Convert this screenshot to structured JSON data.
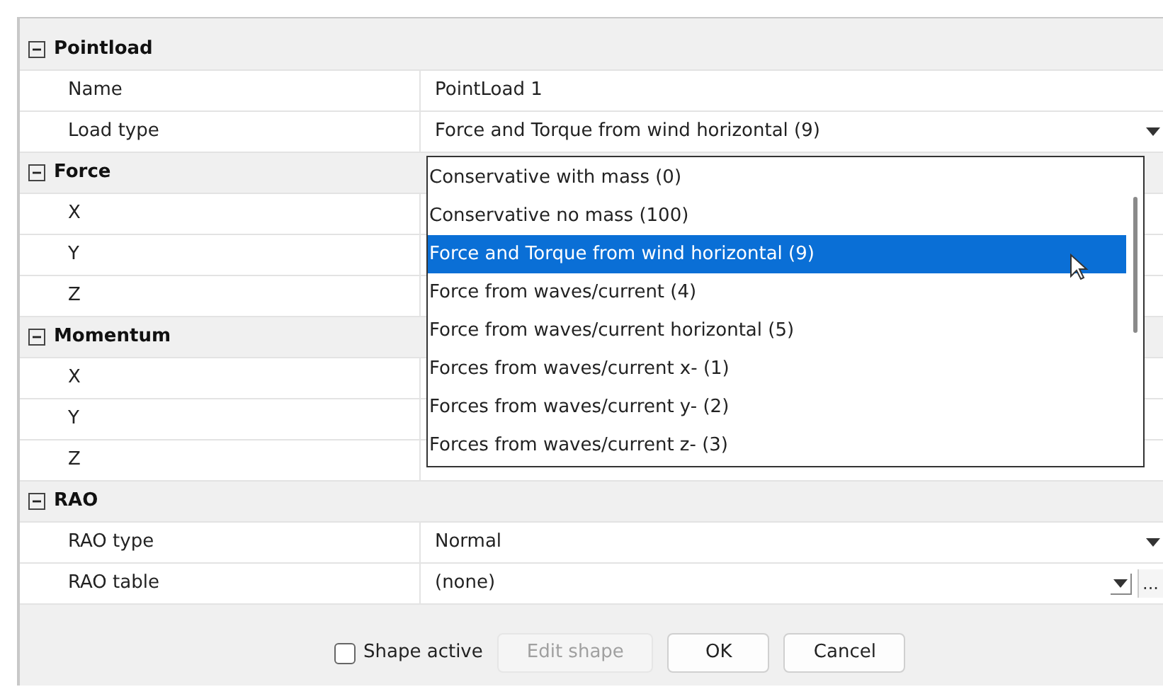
{
  "sections": [
    {
      "title": "Pointload",
      "expanded": true,
      "rows": [
        {
          "label": "Name",
          "kind": "text",
          "value": "PointLoad 1"
        },
        {
          "label": "Load type",
          "kind": "dropdown",
          "value": "Force and Torque from wind horizontal (9)"
        }
      ]
    },
    {
      "title": "Force",
      "expanded": true,
      "rows": [
        {
          "label": "X",
          "kind": "text"
        },
        {
          "label": "Y",
          "kind": "text"
        },
        {
          "label": "Z",
          "kind": "text"
        }
      ]
    },
    {
      "title": "Momentum",
      "expanded": true,
      "rows": [
        {
          "label": "X",
          "kind": "text"
        },
        {
          "label": "Y",
          "kind": "text"
        },
        {
          "label": "Z",
          "kind": "text"
        }
      ]
    },
    {
      "title": "RAO",
      "expanded": true,
      "rows": [
        {
          "label": "RAO type",
          "kind": "dropdown",
          "value": "Normal"
        },
        {
          "label": "RAO table",
          "kind": "browse",
          "value": "(none)",
          "browse": "..."
        }
      ]
    }
  ],
  "dropdown_list": {
    "items": [
      {
        "label": "Conservative with mass (0)",
        "selected": false
      },
      {
        "label": "Conservative no mass (100)",
        "selected": false
      },
      {
        "label": "Force and Torque from wind horizontal (9)",
        "selected": true
      },
      {
        "label": "Force from waves/current (4)",
        "selected": false
      },
      {
        "label": "Force from waves/current horizontal (5)",
        "selected": false
      },
      {
        "label": "Forces from waves/current x- (1)",
        "selected": false
      },
      {
        "label": "Forces from waves/current y- (2)",
        "selected": false
      },
      {
        "label": "Forces from waves/current z- (3)",
        "selected": false
      }
    ]
  },
  "footer": {
    "checkbox": {
      "label": "Shape active",
      "checked": false
    },
    "buttons": [
      {
        "label": "Edit shape",
        "disabled": true
      },
      {
        "label": "OK",
        "disabled": false
      },
      {
        "label": "Cancel",
        "disabled": false
      }
    ]
  }
}
